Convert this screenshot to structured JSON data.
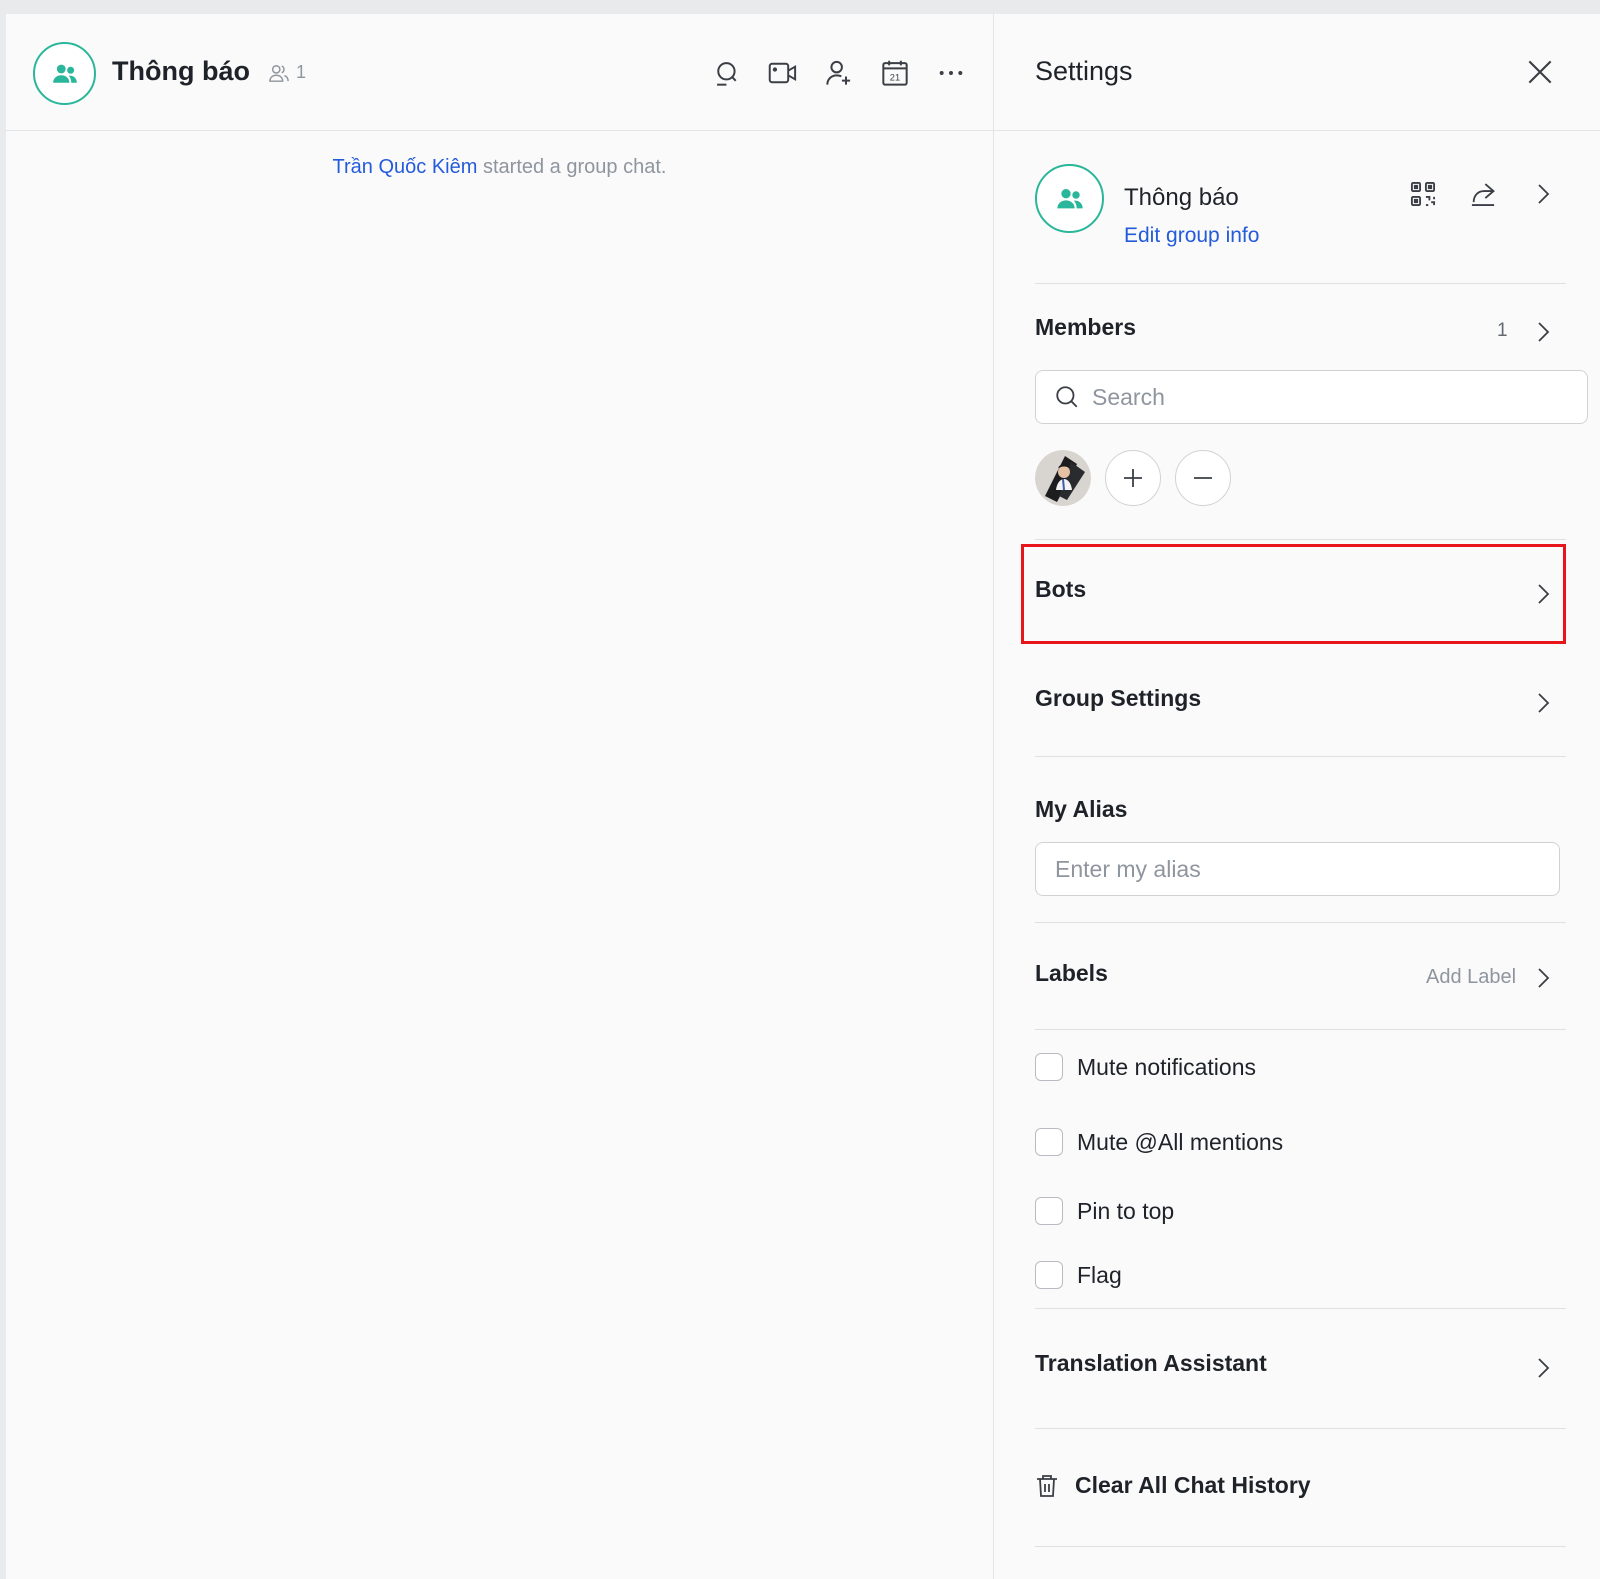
{
  "chat": {
    "title": "Thông báo",
    "member_count": "1",
    "header_icons": [
      "search-icon",
      "video-call-icon",
      "add-member-icon",
      "calendar-icon",
      "more-icon"
    ],
    "calendar_day": "21",
    "system_message": {
      "user": "Trần Quốc Kiêm",
      "text": " started a group chat."
    }
  },
  "settings": {
    "title": "Settings",
    "group": {
      "name": "Thông báo",
      "edit_link": "Edit group info"
    },
    "members": {
      "title": "Members",
      "count": "1",
      "search_placeholder": "Search"
    },
    "bots": {
      "title": "Bots"
    },
    "group_settings": {
      "title": "Group Settings"
    },
    "alias": {
      "title": "My Alias",
      "placeholder": "Enter my alias"
    },
    "labels": {
      "title": "Labels",
      "add": "Add Label"
    },
    "checkboxes": {
      "mute": "Mute notifications",
      "mute_all": "Mute @All mentions",
      "pin": "Pin to top",
      "flag": "Flag"
    },
    "translation": {
      "title": "Translation Assistant"
    },
    "clear_history": "Clear All Chat History"
  },
  "colors": {
    "accent_green": "#2ab69a",
    "link_blue": "#245bdb",
    "highlight_red": "#e8141c"
  }
}
